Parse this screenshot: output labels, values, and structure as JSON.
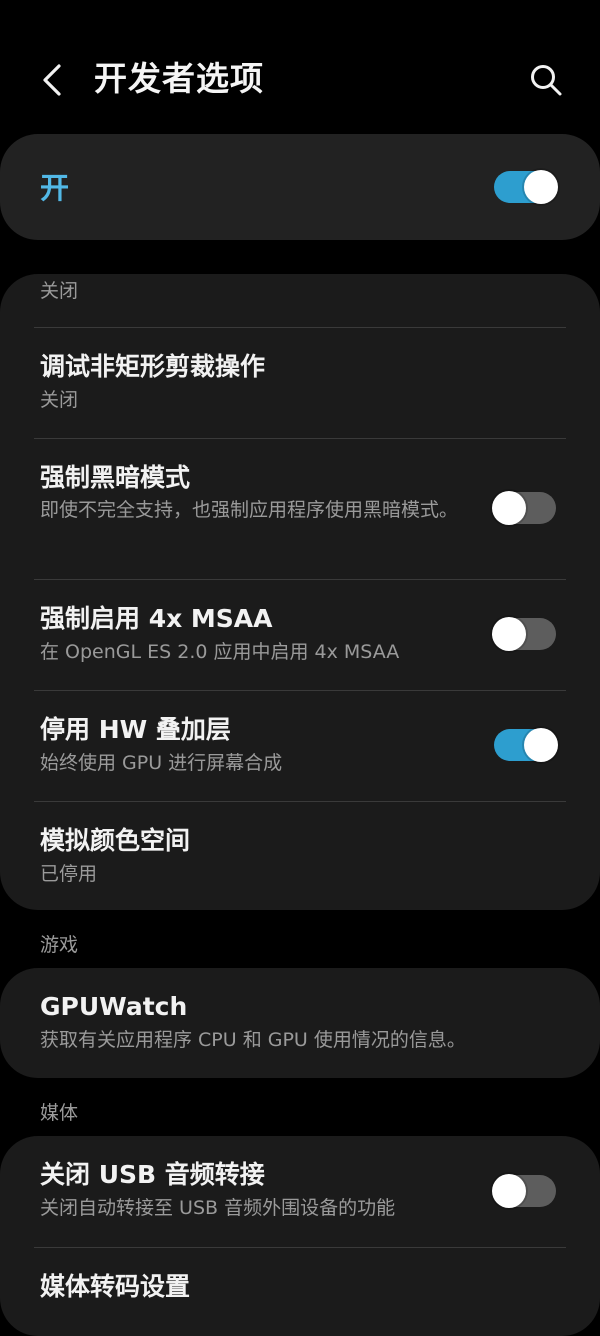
{
  "header": {
    "title": "开发者选项",
    "back_icon": "chevron-left-icon",
    "search_icon": "search-icon"
  },
  "master": {
    "label": "开",
    "toggle_on": true
  },
  "debug_section": {
    "header": "关闭",
    "items": [
      {
        "title": "调试非矩形剪裁操作",
        "subtitle": "关闭"
      },
      {
        "title": "强制黑暗模式",
        "subtitle": "即使不完全支持，也强制应用程序使用黑暗模式。",
        "toggle_on": false
      },
      {
        "title": "强制启用 4x MSAA",
        "subtitle": "在 OpenGL ES 2.0 应用中启用 4x MSAA",
        "toggle_on": false
      },
      {
        "title": "停用 HW 叠加层",
        "subtitle": "始终使用 GPU 进行屏幕合成",
        "toggle_on": true
      },
      {
        "title": "模拟颜色空间",
        "subtitle": "已停用"
      }
    ]
  },
  "games_section": {
    "header": "游戏",
    "items": [
      {
        "title": "GPUWatch",
        "subtitle": "获取有关应用程序 CPU 和 GPU 使用情况的信息。"
      }
    ]
  },
  "media_section": {
    "header": "媒体",
    "items": [
      {
        "title": "关闭 USB 音频转接",
        "subtitle": "关闭自动转接至 USB 音频外围设备的功能",
        "toggle_on": false
      },
      {
        "title": "媒体转码设置"
      }
    ]
  },
  "colors": {
    "background": "#000000",
    "card": "#1b1b1b",
    "accent": "#52b8e6",
    "toggle_on": "#2d9ecf",
    "toggle_off": "#5d5d5d",
    "secondary_text": "#9a9a9a"
  }
}
